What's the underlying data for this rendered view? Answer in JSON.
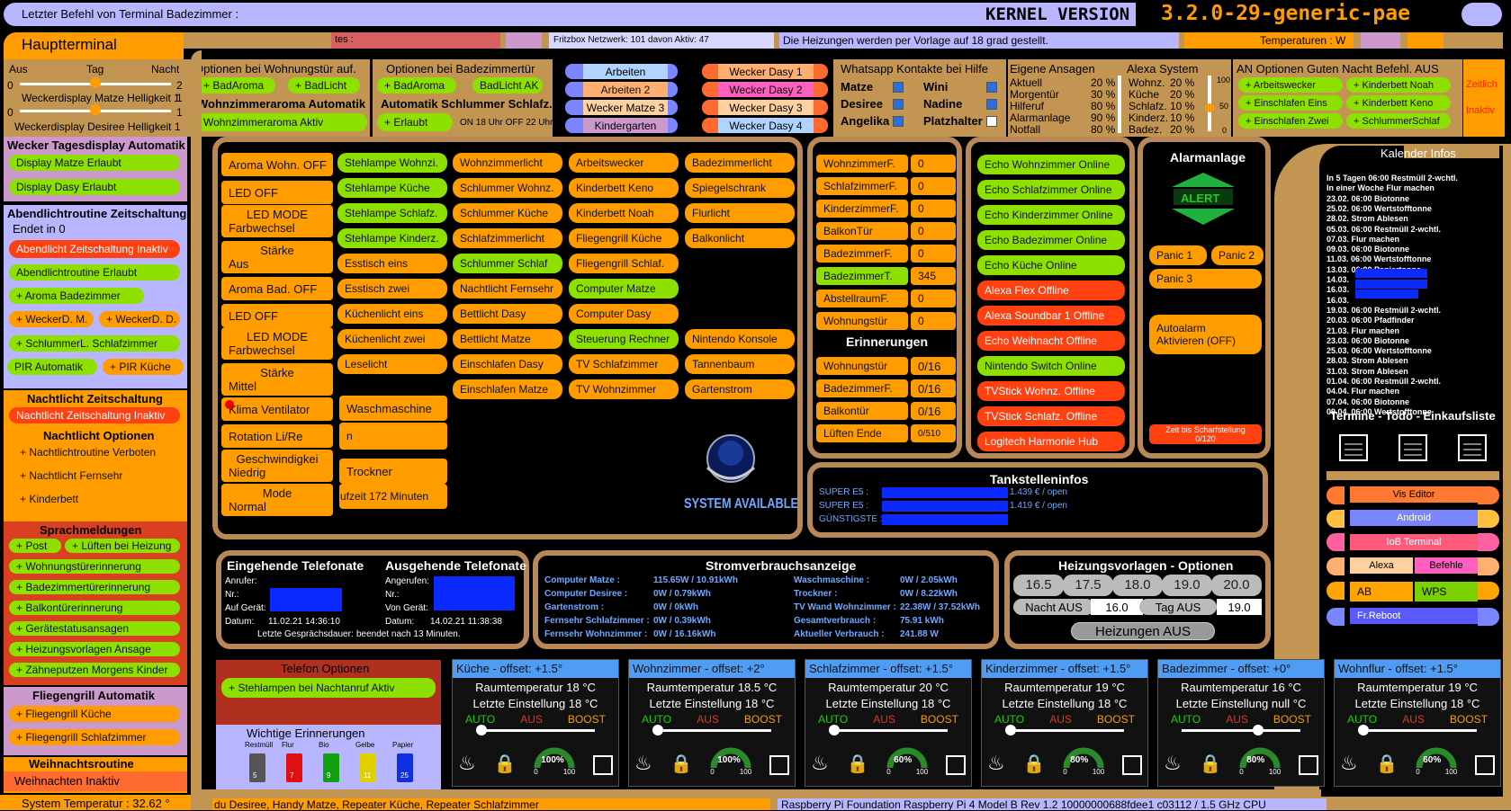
{
  "top": {
    "last_cmd": "Letzter Befehl von Terminal Badezimmer :",
    "kernel_label": "KERNEL VERSION",
    "kernel_version": "3.2.0-29-generic-pae"
  },
  "row2": {
    "haupt": "Hauptterminal",
    "tes": "tes :",
    "fritz": "Fritzbox Netzwerk: 101 davon Aktiv: 47",
    "heizung_msg": "Die Heizungen werden per Vorlage auf 18 grad gestellt.",
    "temp": "Temperaturen : W"
  },
  "bright": {
    "aus": "Aus",
    "tag": "Tag",
    "nacht": "Nacht",
    "d1": "Weckerdisplay Matze Helligkeit 1",
    "d2": "Weckerdisplay Desiree Helligkeit 1",
    "n0": "0",
    "n2": "2",
    "n1": "1"
  },
  "wohnopt": {
    "title": "Optionen bei Wohnungstür auf.",
    "b1": "+ BadAroma",
    "b2": "+ BadLicht",
    "aroma_title": "Wohnzimmeraroma Automatik",
    "aroma_btn": "Wohnzimmeraroma Aktiv"
  },
  "badopt": {
    "title": "Optionen bei Badezimmertür",
    "b1": "+ BadAroma",
    "b2": "BadLicht AK",
    "schl_title": "Automatik Schlummer Schlafz.",
    "schl_btn": "+ Erlaubt",
    "schl_info": "ON 18 Uhr OFF 22 Uhr"
  },
  "dasy": {
    "a": [
      "Arbeiten",
      "Arbeiten 2",
      "Wecker Matze 3",
      "Kindergarten"
    ],
    "b": [
      "Wecker Dasy 1",
      "Wecker Dasy 2",
      "Wecker Dasy 3",
      "Wecker Dasy 4"
    ]
  },
  "whatsapp": {
    "title": "Whatsapp Kontakte bei Hilfe",
    "l": [
      "Matze",
      "Desiree",
      "Angelika"
    ],
    "r": [
      "Wini",
      "Nadine",
      "Platzhalter"
    ]
  },
  "ansagen": {
    "title": "Eigene Ansagen",
    "items": [
      [
        "Aktuell",
        "20 %"
      ],
      [
        "Morgentür",
        "30 %"
      ],
      [
        "Hilferuf",
        "80 %"
      ],
      [
        "Alarmanlage",
        "90 %"
      ],
      [
        "Notfall",
        "80 %"
      ]
    ]
  },
  "alexa": {
    "title": "Alexa System",
    "items": [
      [
        "Wohnz.",
        "20 %"
      ],
      [
        "Küche",
        "20 %"
      ],
      [
        "Schlafz.",
        "10 %"
      ],
      [
        "Kinderz.",
        "10 %"
      ],
      [
        "Badez.",
        "20 %"
      ]
    ],
    "s100": "100",
    "s50": "50",
    "s0": "0"
  },
  "gutenacht": {
    "title": "AN Optionen Guten Nacht Befehl. AUS",
    "items": [
      "+ Arbeitswecker",
      "+ Kinderbett Noah",
      "+ Einschlafen Eins",
      "+ Kinderbett Keno",
      "+ Einschlafen Zwei",
      "+ SchlummerSchlaf"
    ],
    "zeit": "Zeitlich",
    "inaktiv": "Inaktiv"
  },
  "left": {
    "wecker_title": "Wecker Tagesdisplay Automatik",
    "wm": "Display Matze Erlaubt",
    "wd": "Display Dasy Erlaubt",
    "abend_title": "Abendlichtroutine Zeitschaltung",
    "abend_sub": "Endet in 0",
    "abend_z": "Abendlicht Zeitschaltung Inaktiv",
    "abend_e": "Abendlichtroutine Erlaubt",
    "aroma": "+ Aroma Badezimmer",
    "wm2": "+ WeckerD. M.",
    "wd2": "+ WeckerD. D.",
    "schl": "+ SchlummerL. Schlafzimmer",
    "pir": "PIR Automatik",
    "pirk": "+ PIR Küche",
    "nz_title": "Nachtlicht Zeitschaltung",
    "nz": "Nachtlicht Zeitschaltung Inaktiv",
    "no_title": "Nachtlicht Optionen",
    "no": [
      "+ Nachtlichtroutine Verboten",
      "+ Nachtlicht Fernsehr",
      "+ Kinderbett"
    ],
    "sp_title": "Sprachmeldungen",
    "post": "+ Post",
    "luft": "+ Lüften bei Heizung",
    "sp": [
      "+ Wohnungstürerinnerung",
      "+ Badezimmertürerinnerung",
      "+ Balkontürerinnerung",
      "+ Gerätestatusansagen",
      "+ Heizungsvorlagen Ansage",
      "+ Zähneputzen Morgens Kinder"
    ],
    "fg_title": "Fliegengrill Automatik",
    "fg": [
      "+ Fliegengrill Küche",
      "+ Fliegengrill Schlafzimmer"
    ],
    "wr_title": "Weihnachtsroutine",
    "wr": "Weihnachten Inaktiv",
    "systemp": "System Temperatur : 32.62 °"
  },
  "ctrl": {
    "c1": [
      "Aroma Wohn. OFF",
      "LED OFF"
    ],
    "led1": [
      "LED MODE",
      "Farbwechsel"
    ],
    "st1": [
      "Stärke",
      "Aus"
    ],
    "c1b": [
      "Aroma Bad. OFF",
      "LED OFF"
    ],
    "led2": [
      "LED MODE",
      "Farbwechsel"
    ],
    "st2": [
      "Stärke",
      "Mittel"
    ],
    "klima": "Klima Ventilator",
    "rot": "Rotation Li/Re",
    "gesch": [
      "Geschwindigkei",
      "Niedrig"
    ],
    "mode": [
      "Mode",
      "Normal"
    ],
    "c2": [
      "Stehlampe Wohnzi.",
      "Stehlampe Küche",
      "Stehlampe Schlafz.",
      "Stehlampe Kinderz.",
      "Esstisch eins",
      "Esstisch zwei",
      "Küchenlicht eins",
      "Küchenlicht zwei",
      "Leselicht"
    ],
    "c3": [
      "Wohnzimmerlicht",
      "Schlummer Wohnz.",
      "Schlummer Küche",
      "Schlafzimmerlicht",
      "Schlummer Schlaf",
      "Nachtlicht Fernsehr",
      "Bettlicht Dasy",
      "Bettlicht Matze",
      "Einschlafen Dasy",
      "Einschlafen Matze"
    ],
    "c4": [
      "Arbeitswecker",
      "Kinderbett Keno",
      "Kinderbett Noah",
      "Fliegengrill Küche",
      "Fliegengrill Schlaf.",
      "Computer Matze",
      "Computer Dasy",
      "Steuerung Rechner",
      "TV Schlafzimmer",
      "TV Wohnzimmer"
    ],
    "c5": [
      "Badezimmerlicht",
      "Spiegelschrank",
      "Flurlicht",
      "Balkonlicht",
      "Nintendo Konsole",
      "Tannenbaum",
      "Gartenstrom"
    ],
    "wasch": "Waschmaschine",
    "wasch2": "n",
    "trock": "Trockner",
    "trock2": "ufzeit 172 Minuten",
    "system": "SYSTEM AVAILABLE"
  },
  "doors": {
    "names": [
      "WohnzimmerF.",
      "SchlafzimmerF.",
      "KinderzimmerF.",
      "BalkonTür",
      "BadezimmerF.",
      "BadezimmerT.",
      "AbstellraumF.",
      "Wohnungstür"
    ],
    "vals": [
      "0",
      "0",
      "0",
      "0",
      "0",
      "345",
      "0",
      "0"
    ],
    "er_title": "Erinnerungen",
    "er": [
      [
        "Wohnungstür",
        "0/16"
      ],
      [
        "BadezimmerF.",
        "0/16"
      ],
      [
        "Balkontür",
        "0/16"
      ],
      [
        "Lüften Ende",
        "0/510"
      ]
    ]
  },
  "echo": [
    [
      "Echo Wohnzimmer Online",
      "g"
    ],
    [
      "Echo Schlafzimmer Online",
      "g"
    ],
    [
      "Echo Kinderzimmer Online",
      "g"
    ],
    [
      "Echo Badezimmer Online",
      "g"
    ],
    [
      "Echo Küche Online",
      "g"
    ],
    [
      "Alexa Flex Offline",
      "r"
    ],
    [
      "Alexa Soundbar 1 Offline",
      "r"
    ],
    [
      "Echo Weihnacht Offline",
      "r"
    ],
    [
      "Nintendo Switch Online",
      "g"
    ],
    [
      "TVStick Wohnz. Offline",
      "r"
    ],
    [
      "TVStick Schlafz. Offline",
      "r"
    ],
    [
      "Logitech Harmonie Hub",
      "r"
    ]
  ],
  "alarm": {
    "title": "Alarmanlage",
    "alert": "ALERT",
    "p1": "Panic 1",
    "p2": "Panic 2",
    "p3": "Panic 3",
    "auto": [
      "Autoalarm",
      "Aktivieren (OFF)"
    ],
    "zeit": [
      "Zeit bis Scharfstellung",
      "0/120"
    ]
  },
  "kalender": {
    "title": "Kalender Infos",
    "lines": [
      "In 5 Tagen 06:00 Restmüll 2-wchtl.",
      "In einer Woche Flur machen",
      "23.02. 06:00 Biotonne",
      "25.02. 06:00 Wertstofftonne",
      "28.02. Strom Ablesen",
      "05.03. 06:00 Restmüll 2-wchtl.",
      "07.03. Flur machen",
      "09.03. 06:00 Biotonne",
      "11.03. 06:00 Wertstofftonne",
      "13.03. 06:00 Papiertonne",
      "14.03.",
      "16.03.",
      "16.03.",
      "19.03. 06:00 Restmüll 2-wchtl.",
      "20.03. 06:00 Pfadfinder",
      "21.03. Flur machen",
      "23.03. 06:00 Biotonne",
      "25.03. 06:00 Wertstofftonne",
      "28.03. Strom Ablesen",
      "31.03. Strom Ablesen",
      "01.04. 06:00 Restmüll 2-wchtl.",
      "04.04. Flur machen",
      "07.04. 06:00 Biotonne",
      "09.04. 06:00 Wertstofftonne"
    ],
    "tasks": "Termine - Todo - Einkaufsliste",
    "links": [
      [
        "Vis Editor",
        "#ff7a30"
      ],
      [
        "Android",
        "#7a86ff"
      ],
      [
        "IoB Terminal",
        "#ff5a7a"
      ],
      [
        "Alexa",
        "#ffd0a0"
      ],
      [
        "Befehle",
        "#ff60c0"
      ],
      [
        "AB",
        "#ffa500"
      ],
      [
        "WPS",
        "#7ad000"
      ],
      [
        "Fr.Reboot",
        "#5a5aff"
      ]
    ]
  },
  "tank": {
    "title": "Tankstelleninfos",
    "rows": [
      [
        "SUPER E5 :",
        "1.439 € / open"
      ],
      [
        "SUPER E5 :",
        "1.419 € / open"
      ],
      [
        "GÜNSTIGSTE :",
        ""
      ]
    ]
  },
  "tel": {
    "in_title": "Eingehende Telefonate",
    "out_title": "Ausgehende Telefonate",
    "in": [
      [
        "Anrufer:",
        ""
      ],
      [
        "Nr.:",
        ""
      ],
      [
        "Auf Gerät:",
        ""
      ],
      [
        "Datum:",
        "11.02.21 14:36:10"
      ]
    ],
    "out": [
      [
        "Angerufen:",
        ""
      ],
      [
        "Nr.:",
        ""
      ],
      [
        "Von Gerät:",
        ""
      ],
      [
        "Datum:",
        "14.02.21 11:38:38"
      ]
    ],
    "dauer": "Letzte Gesprächsdauer:",
    "dauer_v": "beendet nach 13 Minuten."
  },
  "strom": {
    "title": "Stromverbrauchsanzeige",
    "l": [
      [
        "Computer Matze :",
        "115.65W / 10.91kWh"
      ],
      [
        "Computer Desiree :",
        "0W / 0.79kWh"
      ],
      [
        "Gartenstrom :",
        "0W / 0kWh"
      ],
      [
        "Fernsehr Schlafzimmer :",
        "0W / 0.39kWh"
      ],
      [
        "Fernsehr Wohnzimmer :",
        "0W / 16.16kWh"
      ]
    ],
    "r": [
      [
        "Waschmaschine :",
        "0W / 2.05kWh"
      ],
      [
        "Trockner :",
        "0W / 8.22kWh"
      ],
      [
        "TV Wand Wohnzimmer :",
        "22.38W / 37.52kWh"
      ],
      [
        "Gesamtverbrauch :",
        "75.91 kWh"
      ],
      [
        "Aktueller Verbrauch :",
        "241.88 W"
      ]
    ]
  },
  "heizv": {
    "title": "Heizungsvorlagen - Optionen",
    "temps": [
      "16.5",
      "17.5",
      "18.0",
      "19.0",
      "20.0"
    ],
    "nacht": "Nacht AUS",
    "nacht_v": "16.0",
    "tag": "Tag AUS",
    "tag_v": "19.0",
    "aus": "Heizungen AUS"
  },
  "telopt": {
    "title": "Telefon Optionen",
    "btn": "+ Stehlampen bei Nachtanruf Aktiv"
  },
  "wichtig": {
    "title": "Wichtige Erinnerungen",
    "bins": [
      [
        "Restmüll",
        "5",
        "#555"
      ],
      [
        "Flur",
        "7",
        "#e01010"
      ],
      [
        "Bio",
        "9",
        "#10a010"
      ],
      [
        "Gelbe",
        "11",
        "#e0d000"
      ],
      [
        "Papier",
        "25",
        "#1030e0"
      ]
    ]
  },
  "rooms": [
    [
      "Küche - offset: +1.5°",
      "Raumtemperatur 18 °C",
      "Letzte Einstellung 18 °C",
      "100%"
    ],
    [
      "Wohnzimmer - offset: +2°",
      "Raumtemperatur 18.5 °C",
      "Letzte Einstellung 18 °C",
      "100%"
    ],
    [
      "Schlafzimmer - offset: +1.5°",
      "Raumtemperatur 20 °C",
      "Letzte Einstellung 18 °C",
      "60%"
    ],
    [
      "Kinderzimmer - offset: +1.5°",
      "Raumtemperatur 19 °C",
      "Letzte Einstellung 18 °C",
      "80%"
    ],
    [
      "Badezimmer - offset: +0°",
      "Raumtemperatur 16 °C",
      "Letzte Einstellung null °C",
      "80%"
    ],
    [
      "Wohnflur - offset: +1.5°",
      "Raumtemperatur 19 °C",
      "Letzte Einstellung 18 °C",
      "60%"
    ]
  ],
  "room_modes": {
    "auto": "AUTO",
    "aus": "AUS",
    "boost": "BOOST",
    "g0": "0",
    "g100": "100"
  },
  "bottom": {
    "b1": "du Desiree, Handy Matze, Repeater Küche, Repeater Schlafzimmer",
    "b2": "Raspberry Pi Foundation Raspberry Pi 4 Model B Rev 1.2 10000000688fdee1 c03112 / 1.5 GHz CPU"
  }
}
